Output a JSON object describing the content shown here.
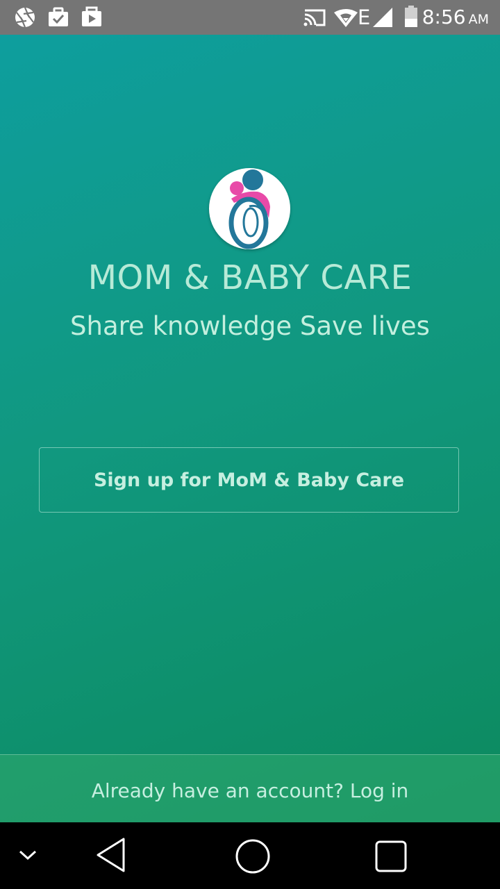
{
  "status_bar": {
    "time": "8:56",
    "ampm": "AM",
    "left_icons": [
      "aperture-icon",
      "briefcase-check-icon",
      "play-store-icon"
    ],
    "right_icons": [
      "cast-icon",
      "wifi-icon",
      "network-e-icon",
      "signal-icon",
      "battery-icon"
    ],
    "network_type": "E"
  },
  "app": {
    "title": "MOM & BABY CARE",
    "tagline": "Share knowledge Save lives",
    "signup_label": "Sign up for MoM & Baby Care",
    "login_text": "Already have an account? Log in",
    "logo_icon": "mother-baby-logo",
    "colors": {
      "gradient_top": "#0e9e9e",
      "gradient_bottom": "#0c8a5e",
      "logo_blue": "#23779a",
      "logo_pink": "#e84aa8"
    }
  },
  "nav_bar": {
    "icons": [
      "chevron-down-icon",
      "back-icon",
      "home-icon",
      "recents-icon"
    ]
  }
}
